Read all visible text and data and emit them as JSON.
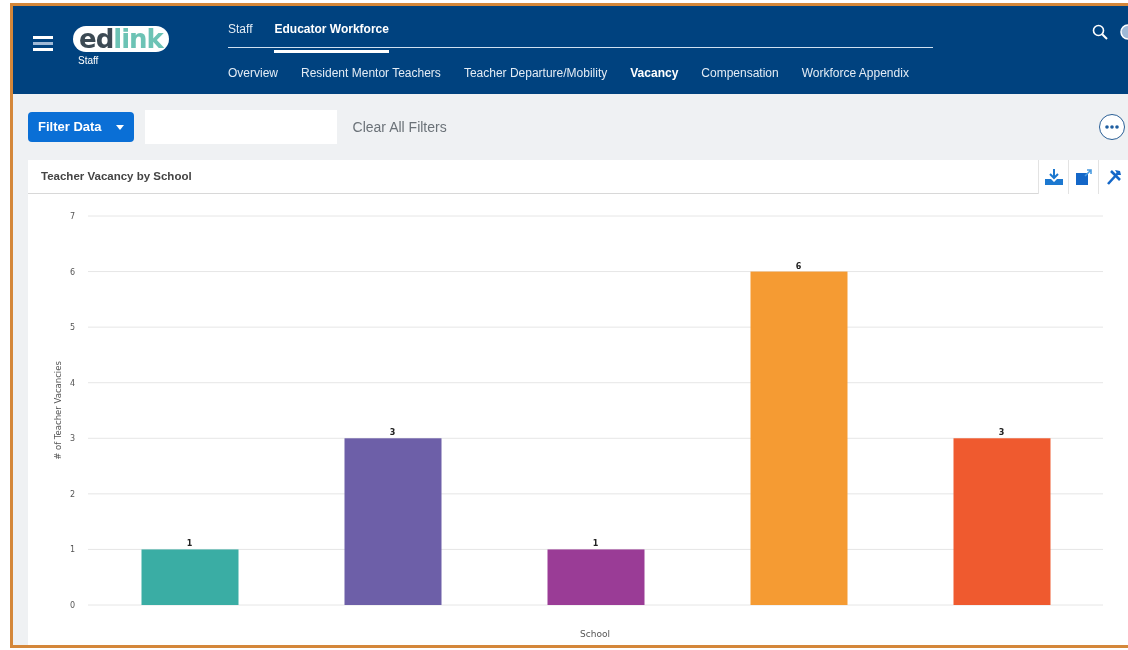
{
  "header": {
    "logo": {
      "first": "ed",
      "second": "link"
    },
    "logo_caption": "Staff",
    "top_tabs": [
      {
        "label": "Staff",
        "selected": false
      },
      {
        "label": "Educator Workforce",
        "selected": true
      }
    ],
    "sub_tabs": [
      {
        "label": "Overview",
        "selected": false
      },
      {
        "label": "Resident Mentor Teachers",
        "selected": false
      },
      {
        "label": "Teacher Departure/Mobility",
        "selected": false
      },
      {
        "label": "Vacancy",
        "selected": true
      },
      {
        "label": "Compensation",
        "selected": false
      },
      {
        "label": "Workforce Appendix",
        "selected": false
      }
    ]
  },
  "filter_bar": {
    "filter_button": "Filter Data",
    "clear_link": "Clear All Filters"
  },
  "chart_card": {
    "title": "Teacher Vacancy by School",
    "chart_data": {
      "type": "bar",
      "xlabel": "School",
      "ylabel": "# of Teacher Vacancies",
      "ylim": [
        0,
        7
      ],
      "yticks": [
        0,
        1,
        2,
        3,
        4,
        5,
        6,
        7
      ],
      "data_labels": true,
      "grid": true,
      "series": [
        {
          "color": "#3aada4",
          "values": [
            1,
            null,
            null,
            null,
            null
          ]
        },
        {
          "color": "#6d5fa8",
          "values": [
            null,
            3,
            null,
            null,
            null
          ]
        },
        {
          "color": "#9a3c96",
          "values": [
            null,
            null,
            1,
            null,
            null
          ]
        },
        {
          "color": "#f59b33",
          "values": [
            null,
            null,
            null,
            6,
            null
          ]
        },
        {
          "color": "#ef5a2f",
          "values": [
            null,
            null,
            null,
            null,
            3
          ]
        }
      ]
    }
  }
}
